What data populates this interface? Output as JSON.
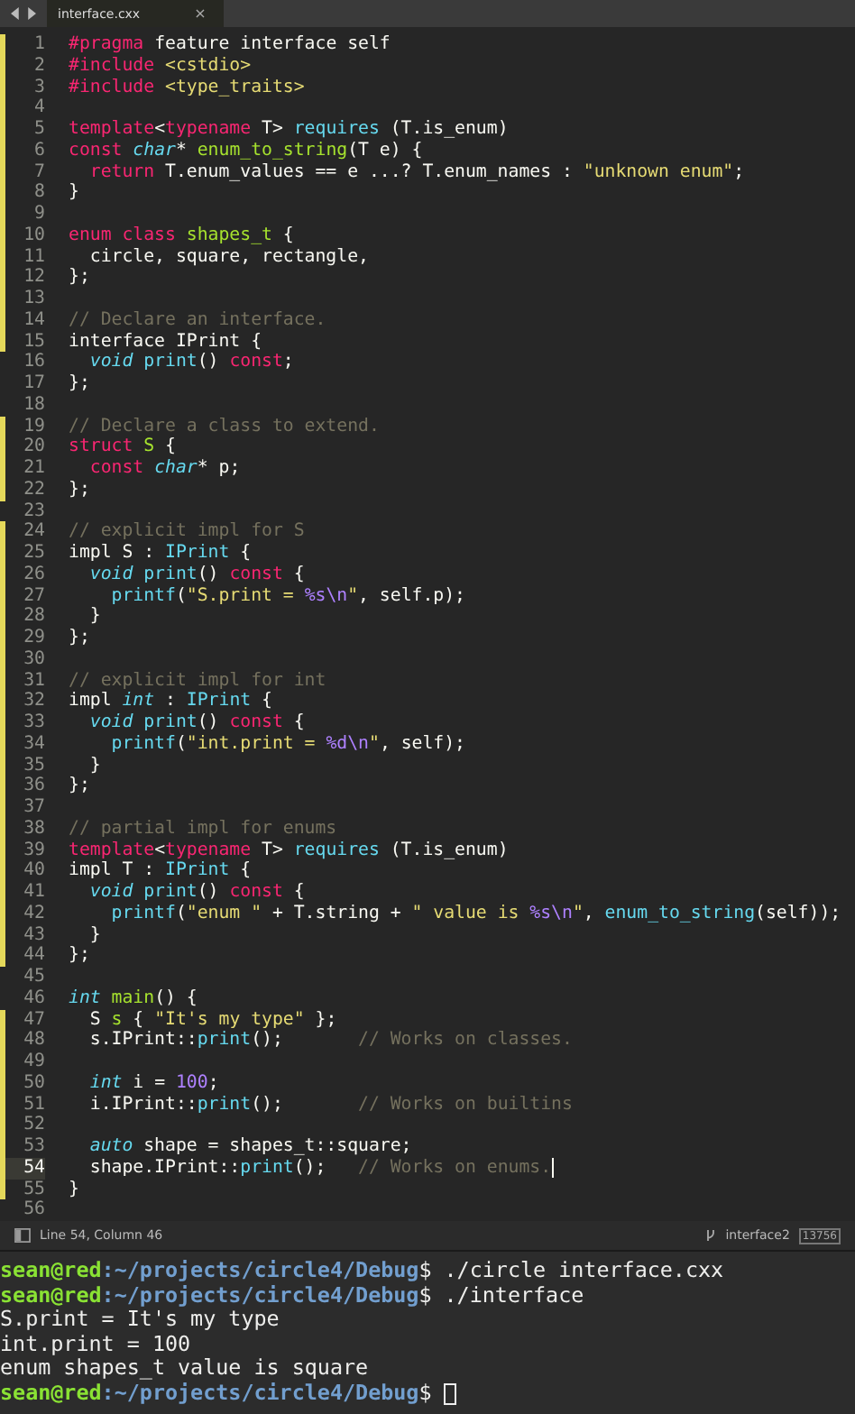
{
  "tabs": [
    {
      "label": "interface.cxx",
      "close": "×",
      "selected": true
    }
  ],
  "editor": {
    "lines": [
      {
        "number": "1",
        "changed": true,
        "current": false,
        "tokens": [
          {
            "kind": "kw",
            "text": "#pragma"
          },
          {
            "kind": "txt",
            "text": " feature interface self"
          }
        ]
      },
      {
        "number": "2",
        "changed": true,
        "current": false,
        "tokens": [
          {
            "kind": "kw",
            "text": "#include"
          },
          {
            "kind": "str",
            "text": " <cstdio>"
          }
        ]
      },
      {
        "number": "3",
        "changed": true,
        "current": false,
        "tokens": [
          {
            "kind": "kw",
            "text": "#include"
          },
          {
            "kind": "str",
            "text": " <type_traits>"
          }
        ]
      },
      {
        "number": "4",
        "changed": true,
        "current": false
      },
      {
        "number": "5",
        "changed": true,
        "current": false,
        "tokens": [
          {
            "kind": "kw",
            "text": "template"
          },
          {
            "kind": "txt",
            "text": "<"
          },
          {
            "kind": "kw",
            "text": "typename"
          },
          {
            "kind": "txt",
            "text": " T> "
          },
          {
            "kind": "fn",
            "text": "requires"
          },
          {
            "kind": "txt",
            "text": " (T.is_enum)"
          }
        ]
      },
      {
        "number": "6",
        "changed": true,
        "current": false,
        "tokens": [
          {
            "kind": "kw",
            "text": "const"
          },
          {
            "kind": "type",
            "text": " char"
          },
          {
            "kind": "txt",
            "text": "* "
          },
          {
            "kind": "name",
            "text": "enum_to_string"
          },
          {
            "kind": "txt",
            "text": "(T e) {"
          }
        ]
      },
      {
        "number": "7",
        "changed": true,
        "current": false,
        "tokens": [
          {
            "kind": "kw",
            "text": "  return"
          },
          {
            "kind": "txt",
            "text": " T.enum_values == e ...? T.enum_names : "
          },
          {
            "kind": "str",
            "text": "\"unknown enum\""
          },
          {
            "kind": "txt",
            "text": ";"
          }
        ]
      },
      {
        "number": "8",
        "changed": true,
        "current": false,
        "tokens": [
          {
            "kind": "txt",
            "text": "}"
          }
        ]
      },
      {
        "number": "9",
        "changed": true,
        "current": false
      },
      {
        "number": "10",
        "changed": true,
        "current": false,
        "tokens": [
          {
            "kind": "kw",
            "text": "enum class"
          },
          {
            "kind": "name",
            "text": " shapes_t"
          },
          {
            "kind": "txt",
            "text": " {"
          }
        ]
      },
      {
        "number": "11",
        "changed": true,
        "current": false,
        "tokens": [
          {
            "kind": "txt",
            "text": "  circle, square, rectangle,"
          }
        ]
      },
      {
        "number": "12",
        "changed": true,
        "current": false,
        "tokens": [
          {
            "kind": "txt",
            "text": "};"
          }
        ]
      },
      {
        "number": "13",
        "changed": true,
        "current": false
      },
      {
        "number": "14",
        "changed": true,
        "current": false,
        "tokens": [
          {
            "kind": "cmt",
            "text": "// Declare an interface."
          }
        ]
      },
      {
        "number": "15",
        "changed": true,
        "current": false,
        "tokens": [
          {
            "kind": "txt",
            "text": "interface IPrint {"
          }
        ]
      },
      {
        "number": "16",
        "changed": false,
        "current": false,
        "tokens": [
          {
            "kind": "type",
            "text": "  void"
          },
          {
            "kind": "fn",
            "text": " print"
          },
          {
            "kind": "txt",
            "text": "() "
          },
          {
            "kind": "kw",
            "text": "const"
          },
          {
            "kind": "txt",
            "text": ";"
          }
        ]
      },
      {
        "number": "17",
        "changed": false,
        "current": false,
        "tokens": [
          {
            "kind": "txt",
            "text": "};"
          }
        ]
      },
      {
        "number": "18",
        "changed": false,
        "current": false
      },
      {
        "number": "19",
        "changed": true,
        "current": false,
        "tokens": [
          {
            "kind": "cmt",
            "text": "// Declare a class to extend."
          }
        ]
      },
      {
        "number": "20",
        "changed": true,
        "current": false,
        "tokens": [
          {
            "kind": "kw",
            "text": "struct"
          },
          {
            "kind": "name",
            "text": " S"
          },
          {
            "kind": "txt",
            "text": " {"
          }
        ]
      },
      {
        "number": "21",
        "changed": true,
        "current": false,
        "tokens": [
          {
            "kind": "kw",
            "text": "  const"
          },
          {
            "kind": "type",
            "text": " char"
          },
          {
            "kind": "txt",
            "text": "* p;"
          }
        ]
      },
      {
        "number": "22",
        "changed": true,
        "current": false,
        "tokens": [
          {
            "kind": "txt",
            "text": "};"
          }
        ]
      },
      {
        "number": "23",
        "changed": false,
        "current": false
      },
      {
        "number": "24",
        "changed": true,
        "current": false,
        "tokens": [
          {
            "kind": "cmt",
            "text": "// explicit impl for S"
          }
        ]
      },
      {
        "number": "25",
        "changed": true,
        "current": false,
        "tokens": [
          {
            "kind": "txt",
            "text": "impl S : "
          },
          {
            "kind": "fn",
            "text": "IPrint"
          },
          {
            "kind": "txt",
            "text": " {"
          }
        ]
      },
      {
        "number": "26",
        "changed": true,
        "current": false,
        "tokens": [
          {
            "kind": "type",
            "text": "  void"
          },
          {
            "kind": "fn",
            "text": " print"
          },
          {
            "kind": "txt",
            "text": "() "
          },
          {
            "kind": "kw",
            "text": "const"
          },
          {
            "kind": "txt",
            "text": " {"
          }
        ]
      },
      {
        "number": "27",
        "changed": true,
        "current": false,
        "tokens": [
          {
            "kind": "fn",
            "text": "    printf"
          },
          {
            "kind": "txt",
            "text": "("
          },
          {
            "kind": "str",
            "text": "\"S.print = "
          },
          {
            "kind": "esc",
            "text": "%s\\n"
          },
          {
            "kind": "str",
            "text": "\""
          },
          {
            "kind": "txt",
            "text": ", self.p);"
          }
        ]
      },
      {
        "number": "28",
        "changed": true,
        "current": false,
        "tokens": [
          {
            "kind": "txt",
            "text": "  }"
          }
        ]
      },
      {
        "number": "29",
        "changed": true,
        "current": false,
        "tokens": [
          {
            "kind": "txt",
            "text": "};"
          }
        ]
      },
      {
        "number": "30",
        "changed": true,
        "current": false
      },
      {
        "number": "31",
        "changed": true,
        "current": false,
        "tokens": [
          {
            "kind": "cmt",
            "text": "// explicit impl for int"
          }
        ]
      },
      {
        "number": "32",
        "changed": true,
        "current": false,
        "tokens": [
          {
            "kind": "txt",
            "text": "impl "
          },
          {
            "kind": "type",
            "text": "int"
          },
          {
            "kind": "txt",
            "text": " : "
          },
          {
            "kind": "fn",
            "text": "IPrint"
          },
          {
            "kind": "txt",
            "text": " {"
          }
        ]
      },
      {
        "number": "33",
        "changed": true,
        "current": false,
        "tokens": [
          {
            "kind": "type",
            "text": "  void"
          },
          {
            "kind": "fn",
            "text": " print"
          },
          {
            "kind": "txt",
            "text": "() "
          },
          {
            "kind": "kw",
            "text": "const"
          },
          {
            "kind": "txt",
            "text": " {"
          }
        ]
      },
      {
        "number": "34",
        "changed": true,
        "current": false,
        "tokens": [
          {
            "kind": "fn",
            "text": "    printf"
          },
          {
            "kind": "txt",
            "text": "("
          },
          {
            "kind": "str",
            "text": "\"int.print = "
          },
          {
            "kind": "esc",
            "text": "%d\\n"
          },
          {
            "kind": "str",
            "text": "\""
          },
          {
            "kind": "txt",
            "text": ", self);"
          }
        ]
      },
      {
        "number": "35",
        "changed": true,
        "current": false,
        "tokens": [
          {
            "kind": "txt",
            "text": "  }"
          }
        ]
      },
      {
        "number": "36",
        "changed": true,
        "current": false,
        "tokens": [
          {
            "kind": "txt",
            "text": "};"
          }
        ]
      },
      {
        "number": "37",
        "changed": true,
        "current": false
      },
      {
        "number": "38",
        "changed": true,
        "current": false,
        "tokens": [
          {
            "kind": "cmt",
            "text": "// partial impl for enums"
          }
        ]
      },
      {
        "number": "39",
        "changed": true,
        "current": false,
        "tokens": [
          {
            "kind": "kw",
            "text": "template"
          },
          {
            "kind": "txt",
            "text": "<"
          },
          {
            "kind": "kw",
            "text": "typename"
          },
          {
            "kind": "txt",
            "text": " T> "
          },
          {
            "kind": "fn",
            "text": "requires"
          },
          {
            "kind": "txt",
            "text": " (T.is_enum)"
          }
        ]
      },
      {
        "number": "40",
        "changed": true,
        "current": false,
        "tokens": [
          {
            "kind": "txt",
            "text": "impl T : "
          },
          {
            "kind": "fn",
            "text": "IPrint"
          },
          {
            "kind": "txt",
            "text": " {"
          }
        ]
      },
      {
        "number": "41",
        "changed": true,
        "current": false,
        "tokens": [
          {
            "kind": "type",
            "text": "  void"
          },
          {
            "kind": "fn",
            "text": " print"
          },
          {
            "kind": "txt",
            "text": "() "
          },
          {
            "kind": "kw",
            "text": "const"
          },
          {
            "kind": "txt",
            "text": " {"
          }
        ]
      },
      {
        "number": "42",
        "changed": true,
        "current": false,
        "tokens": [
          {
            "kind": "fn",
            "text": "    printf"
          },
          {
            "kind": "txt",
            "text": "("
          },
          {
            "kind": "str",
            "text": "\"enum \""
          },
          {
            "kind": "txt",
            "text": " + T.string + "
          },
          {
            "kind": "str",
            "text": "\" value is "
          },
          {
            "kind": "esc",
            "text": "%s\\n"
          },
          {
            "kind": "str",
            "text": "\""
          },
          {
            "kind": "txt",
            "text": ", "
          },
          {
            "kind": "fn",
            "text": "enum_to_string"
          },
          {
            "kind": "txt",
            "text": "(self));"
          }
        ]
      },
      {
        "number": "43",
        "changed": true,
        "current": false,
        "tokens": [
          {
            "kind": "txt",
            "text": "  }"
          }
        ]
      },
      {
        "number": "44",
        "changed": true,
        "current": false,
        "tokens": [
          {
            "kind": "txt",
            "text": "};"
          }
        ]
      },
      {
        "number": "45",
        "changed": false,
        "current": false
      },
      {
        "number": "46",
        "changed": false,
        "current": false,
        "tokens": [
          {
            "kind": "type",
            "text": "int"
          },
          {
            "kind": "name",
            "text": " main"
          },
          {
            "kind": "txt",
            "text": "() {"
          }
        ]
      },
      {
        "number": "47",
        "changed": true,
        "current": false,
        "tokens": [
          {
            "kind": "txt",
            "text": "  S "
          },
          {
            "kind": "name",
            "text": "s"
          },
          {
            "kind": "txt",
            "text": " { "
          },
          {
            "kind": "str",
            "text": "\"It's my type\""
          },
          {
            "kind": "txt",
            "text": " };"
          }
        ]
      },
      {
        "number": "48",
        "changed": true,
        "current": false,
        "tokens": [
          {
            "kind": "txt",
            "text": "  s.IPrint::"
          },
          {
            "kind": "fn",
            "text": "print"
          },
          {
            "kind": "txt",
            "text": "();       "
          },
          {
            "kind": "cmt",
            "text": "// Works on classes."
          }
        ]
      },
      {
        "number": "49",
        "changed": true,
        "current": false
      },
      {
        "number": "50",
        "changed": true,
        "current": false,
        "tokens": [
          {
            "kind": "type",
            "text": "  int"
          },
          {
            "kind": "txt",
            "text": " i = "
          },
          {
            "kind": "num",
            "text": "100"
          },
          {
            "kind": "txt",
            "text": ";"
          }
        ]
      },
      {
        "number": "51",
        "changed": true,
        "current": false,
        "tokens": [
          {
            "kind": "txt",
            "text": "  i.IPrint::"
          },
          {
            "kind": "fn",
            "text": "print"
          },
          {
            "kind": "txt",
            "text": "();       "
          },
          {
            "kind": "cmt",
            "text": "// Works on builtins"
          }
        ]
      },
      {
        "number": "52",
        "changed": true,
        "current": false
      },
      {
        "number": "53",
        "changed": true,
        "current": false,
        "tokens": [
          {
            "kind": "type",
            "text": "  auto"
          },
          {
            "kind": "txt",
            "text": " shape = shapes_t::square;"
          }
        ]
      },
      {
        "number": "54",
        "changed": true,
        "current": true,
        "tokens": [
          {
            "kind": "txt",
            "text": "  shape.IPrint::"
          },
          {
            "kind": "fn",
            "text": "print"
          },
          {
            "kind": "txt",
            "text": "();   "
          },
          {
            "kind": "cmt",
            "text": "// Works on enums."
          }
        ]
      },
      {
        "number": "55",
        "changed": true,
        "current": false,
        "tokens": [
          {
            "kind": "txt",
            "text": "}"
          }
        ]
      },
      {
        "number": "56",
        "changed": false,
        "current": false
      }
    ]
  },
  "status_bar": {
    "position": "Line 54, Column 46",
    "branch": "interface2",
    "changes": "13756"
  },
  "terminal": {
    "lines": [
      {
        "kind": "prompt",
        "user": "sean@red",
        "path": ":~/projects/circle4/Debug",
        "symbol": "$",
        "command": "./circle interface.cxx",
        "cursor": false
      },
      {
        "kind": "prompt",
        "user": "sean@red",
        "path": ":~/projects/circle4/Debug",
        "symbol": "$",
        "command": "./interface",
        "cursor": false
      },
      {
        "kind": "output",
        "text": "S.print = It's my type"
      },
      {
        "kind": "output",
        "text": "int.print = 100"
      },
      {
        "kind": "output",
        "text": "enum shapes_t value is square"
      },
      {
        "kind": "prompt",
        "user": "sean@red",
        "path": ":~/projects/circle4/Debug",
        "symbol": "$",
        "cursor": true
      }
    ]
  }
}
